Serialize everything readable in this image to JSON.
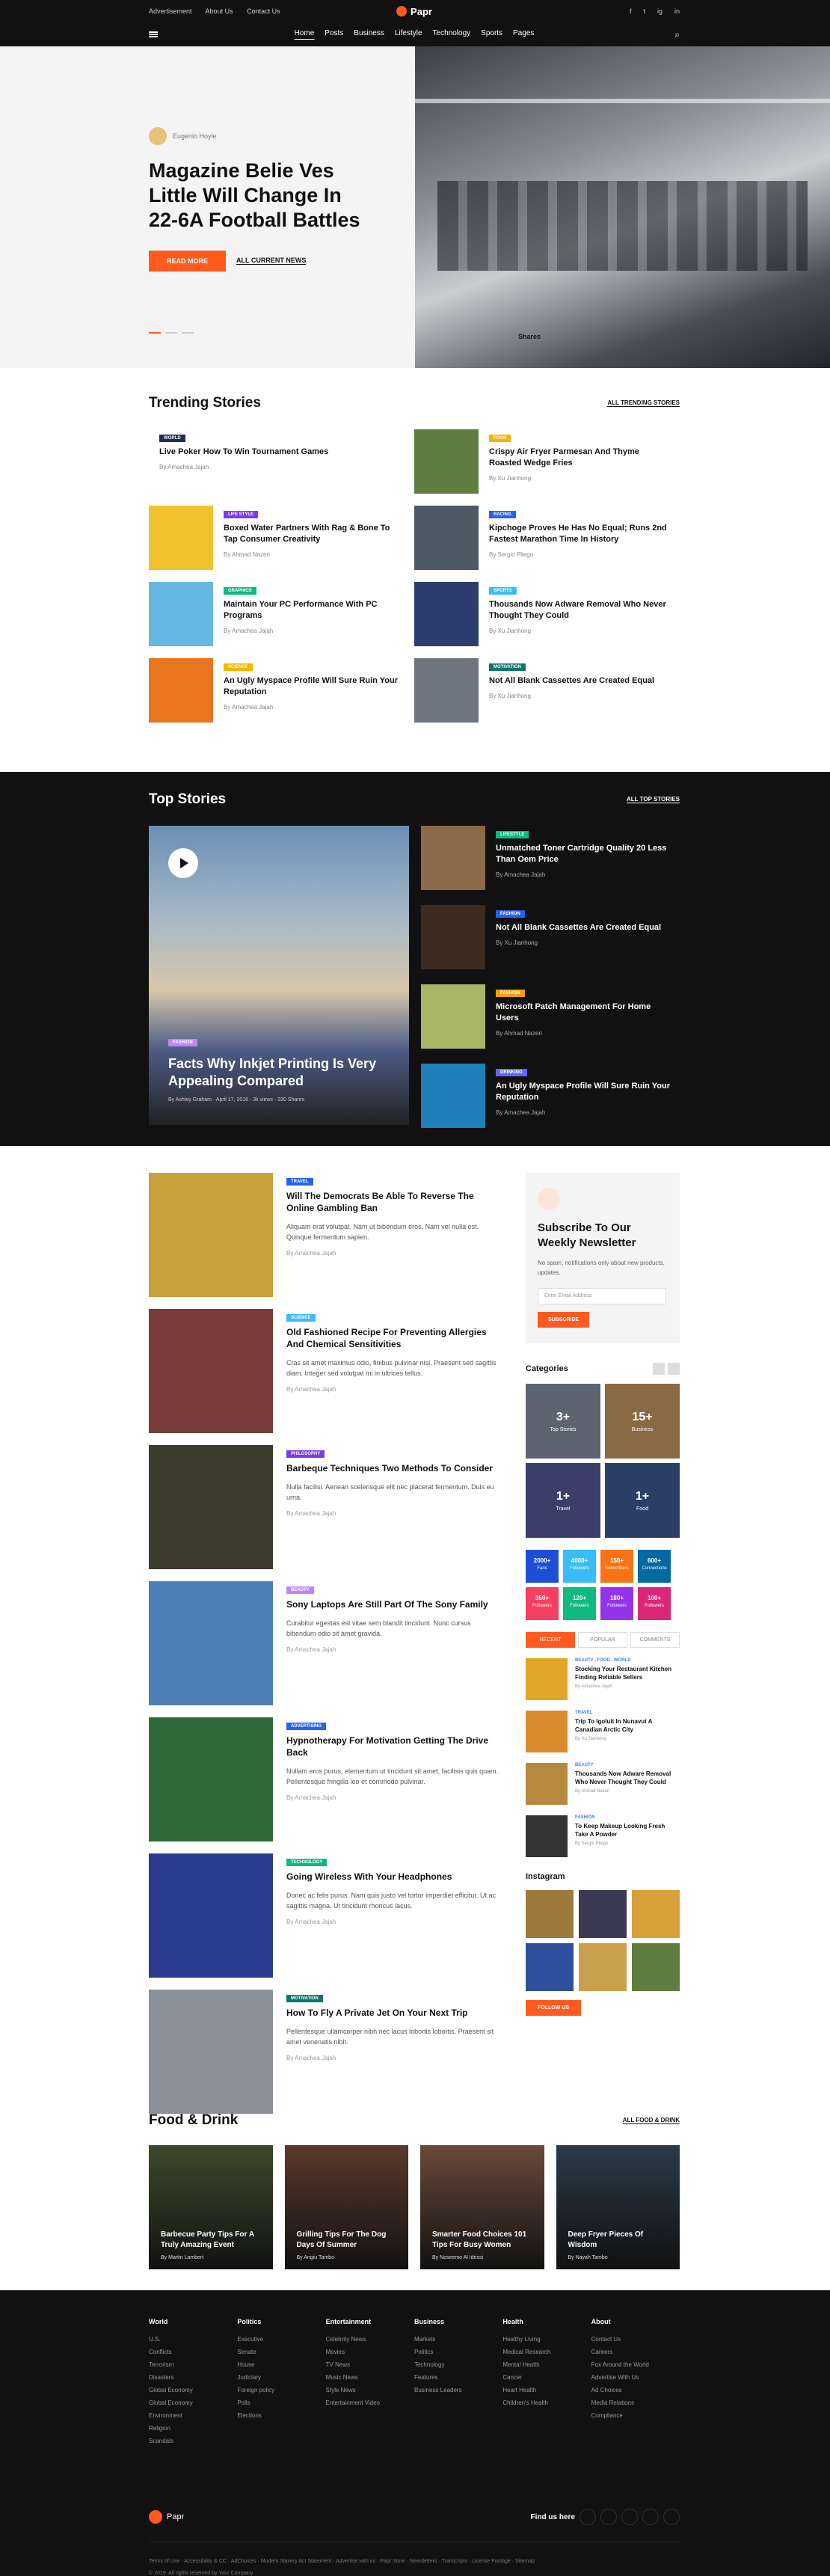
{
  "topbar": {
    "links": [
      "Advertisement",
      "About Us",
      "Contact Us"
    ],
    "logo": "Papr",
    "social": [
      "f",
      "t",
      "ig",
      "in"
    ]
  },
  "nav": {
    "items": [
      "Home",
      "Posts",
      "Business",
      "Lifestyle",
      "Technology",
      "Sports",
      "Pages"
    ]
  },
  "hero": {
    "author": "Eugenio Hoyle",
    "title": "Magazine Belie Ves Little Will Change In 22-6A Football Battles",
    "button": "READ MORE",
    "link": "ALL CURRENT NEWS",
    "shares": "Shares"
  },
  "trending": {
    "title": "Trending Stories",
    "link": "ALL TRENDING STORIES",
    "items": [
      {
        "badge": "WORLD",
        "color": "#1f2d5a",
        "title": "Live Poker How To Win Tournament Games",
        "by": "By Amachea Jajah",
        "img": "none"
      },
      {
        "badge": "FOOD",
        "color": "#f4b400",
        "title": "Crispy Air Fryer Parmesan And Thyme Roasted Wedge Fries",
        "by": "By Xu Jianhong",
        "img": "#5f7d3e"
      },
      {
        "badge": "LIFE STYLE",
        "color": "#7c3aed",
        "title": "Boxed Water Partners With Rag & Bone To Tap Consumer Creativity",
        "by": "By Ahmad Nazeri",
        "img": "#f2c12e"
      },
      {
        "badge": "RACING",
        "color": "#2563eb",
        "title": "Kipchoge Proves He Has No Equal; Runs 2nd Fastest Marathon Time In History",
        "by": "By Sergio Pliego",
        "img": "#4e5a66"
      },
      {
        "badge": "GRAPHICS",
        "color": "#10b981",
        "title": "Maintain Your PC Performance With PC Programs",
        "by": "By Amachea Jajah",
        "img": "#67b7e6"
      },
      {
        "badge": "SPORTS",
        "color": "#38bdf8",
        "title": "Thousands Now Adware Removal Who Never Thought They Could",
        "by": "By Xu Jianhong",
        "img": "#2c3e70"
      },
      {
        "badge": "SCIENCE",
        "color": "#f4b400",
        "title": "An Ugly Myspace Profile Will Sure Ruin Your Reputation",
        "by": "By Amachea Jajah",
        "img": "#e8761e"
      },
      {
        "badge": "MOTIVATION",
        "color": "#0f766e",
        "title": "Not All Blank Cassettes Are Created Equal",
        "by": "By Xu Jianhong",
        "img": "#6d7680"
      }
    ]
  },
  "top_stories": {
    "title": "Top Stories",
    "link": "ALL TOP STORIES",
    "main": {
      "badge": "FASHION",
      "title": "Facts Why Inkjet Printing Is Very Appealing Compared",
      "meta": "By Ashley Graham  ·  April 17, 2016  ·  3k views  ·  330 Shares"
    },
    "items": [
      {
        "badge": "LIFESTYLE",
        "color": "#10b981",
        "title": "Unmatched Toner Cartridge Quality 20 Less Than Oem Price",
        "by": "By Amachea Jajah",
        "img": "#8a6a4a"
      },
      {
        "badge": "FASHION",
        "color": "#2563eb",
        "title": "Not All Blank Cassettes Are Created Equal",
        "by": "By Xu Jianhong",
        "img": "#3d2b1f"
      },
      {
        "badge": "FASHION",
        "color": "#f59e0b",
        "title": "Microsoft Patch Management For Home Users",
        "by": "By Ahmad Nazeri",
        "img": "#a8b565"
      },
      {
        "badge": "DRINKING",
        "color": "#6366f1",
        "title": "An Ugly Myspace Profile Will Sure Ruin Your Reputation",
        "by": "By Amachea Jajah",
        "img": "#1e7fb8"
      }
    ]
  },
  "posts": [
    {
      "badge": "TRAVEL",
      "color": "#2563eb",
      "title": "Will The Democrats Be Able To Reverse The Online Gambling Ban",
      "desc": "Aliquam erat volutpat. Nam ut bibendum eros. Nam vel nulla est. Quisque fermentum sapien.",
      "by": "By Amachea Jajah",
      "img": "#c9a13a"
    },
    {
      "badge": "SCIENCE",
      "color": "#38bdf8",
      "title": "Old Fashioned Recipe For Preventing Allergies And Chemical Sensitivities",
      "desc": "Cras sit amet maximus odio, finibus pulvinar nisl. Praesent sed sagittis diam. Integer sed volutpat mi in ultrices tellus.",
      "by": "By Amachea Jajah",
      "img": "#7a3b3b"
    },
    {
      "badge": "PHILOSOPHY",
      "color": "#7c3aed",
      "title": "Barbeque Techniques Two Methods To Consider",
      "desc": "Nulla facilisi. Aenean scelerisque elit nec placerat fermentum. Duis eu urna.",
      "by": "By Amachea Jajah",
      "img": "#3b3b2e"
    },
    {
      "badge": "BEAUTY",
      "color": "#c084fc",
      "title": "Sony Laptops Are Still Part Of The Sony Family",
      "desc": "Curabitur egestas est vitae sem blandit tincidunt. Nunc cursus bibendum odio sit amet gravida.",
      "by": "By Amachea Jajah",
      "img": "#4f7fb8"
    },
    {
      "badge": "ADVERTISING",
      "color": "#2563eb",
      "title": "Hypnotherapy For Motivation Getting The Drive Back",
      "desc": "Nullam eros purus, elementum ut tincidunt sit amet, facilisis quis quam. Pellentesque fringilla leo et commodo pulvinar.",
      "by": "By Amachea Jajah",
      "img": "#2f6b3a"
    },
    {
      "badge": "TECHNOLOGY",
      "color": "#10b981",
      "title": "Going Wireless With Your Headphones",
      "desc": "Donec ac felis purus. Nam quis justo vel tortor imperdiet efficitur. Ut ac sagittis magna. Ut tincidunt rhoncus lacus.",
      "by": "By Amachea Jajah",
      "img": "#2b3c8f"
    },
    {
      "badge": "MOTIVATION",
      "color": "#0f766e",
      "title": "How To Fly A Private Jet On Your Next Trip",
      "desc": "Pellentesque ullamcorper nibh nec lacus lobortis lobortis. Praesent sit amet venenatis nibh.",
      "by": "By Amachea Jajah",
      "img": "#8a9099"
    }
  ],
  "sidebar": {
    "newsletter": {
      "title": "Subscribe To Our Weekly Newsletter",
      "desc": "No spam, notifications only about new products, updates.",
      "placeholder": "Enter Email Address",
      "button": "SUBSCRIBE"
    },
    "categories_title": "Categories",
    "categories": [
      {
        "count": "3+",
        "name": "Top Stories",
        "color": "#5b6470"
      },
      {
        "count": "15+",
        "name": "Business",
        "color": "#8a6a45"
      },
      {
        "count": "1+",
        "name": "Travel",
        "color": "#3a3f6a"
      },
      {
        "count": "1+",
        "name": "Food",
        "color": "#2c3f66"
      }
    ],
    "social": [
      {
        "n": "2000+",
        "l": "Fans",
        "c": "#1d4ed8"
      },
      {
        "n": "4000+",
        "l": "Followers",
        "c": "#38bdf8"
      },
      {
        "n": "150+",
        "l": "Subscribers",
        "c": "#f97316"
      },
      {
        "n": "600+",
        "l": "Connections",
        "c": "#0369a1"
      },
      {
        "n": "350+",
        "l": "Followers",
        "c": "#f43f5e"
      },
      {
        "n": "120+",
        "l": "Followers",
        "c": "#10b981"
      },
      {
        "n": "180+",
        "l": "Followers",
        "c": "#9333ea"
      },
      {
        "n": "100+",
        "l": "Followers",
        "c": "#db2777"
      }
    ],
    "tabs": [
      "RECENT",
      "POPULAR",
      "COMMENTS"
    ],
    "popular": [
      {
        "cat": "BEAUTY , FOOD , WORLD",
        "title": "Stocking Your Restaurant Kitchen Finding Reliable Sellers",
        "by": "By Amachea Jajah",
        "img": "#e2a526"
      },
      {
        "cat": "TRAVEL",
        "title": "Trip To Igoluit In Nunavut A Canadian Arctic City",
        "by": "By Xu Jianhong",
        "img": "#d98a2b"
      },
      {
        "cat": "BEAUTY",
        "title": "Thousands Now Adware Removal Who Never Thought They Could",
        "by": "By Ahmad Nazeri",
        "img": "#b7893f"
      },
      {
        "cat": "FASHION",
        "title": "To Keep Makeup Looking Fresh Take A Powder",
        "by": "By Sergio Pliego",
        "img": "#333"
      }
    ],
    "instagram_title": "Instagram",
    "instagram": [
      "#9b7a3c",
      "#3c3a52",
      "#d9a03a",
      "#2f4f9b",
      "#c9a04b",
      "#5f7d3e"
    ],
    "follow": "FOLLOW US"
  },
  "food": {
    "title": "Food & Drink",
    "link": "ALL FOOD & DRINK",
    "items": [
      {
        "title": "Barbecue Party Tips For A Truly Amazing Event",
        "by": "By Martin Lambert",
        "img": "#3d4a2a"
      },
      {
        "title": "Grilling Tips For The Dog Days Of Summer",
        "by": "By Angiu Tambo",
        "img": "#5a3a2a"
      },
      {
        "title": "Smarter Food Choices 101 Tips For Busy Women",
        "by": "By Noseemo Al Idrissi",
        "img": "#6a4a3a"
      },
      {
        "title": "Deep Fryer Pieces Of Wisdom",
        "by": "By Nayah Tambo",
        "img": "#2a3a4a"
      }
    ]
  },
  "footer": {
    "cols": [
      {
        "h": "World",
        "items": [
          "U.S.",
          "Conflicts",
          "Terrorism",
          "Disasters",
          "Global Economy",
          "Global Economy",
          "Environment",
          "Religion",
          "Scandals"
        ]
      },
      {
        "h": "Politics",
        "items": [
          "Executive",
          "Senate",
          "House",
          "Judiciary",
          "Foreign policy",
          "Polls",
          "Elections"
        ]
      },
      {
        "h": "Entertainment",
        "items": [
          "Celebrity News",
          "Movies",
          "TV News",
          "Music News",
          "Style News",
          "Entertainment Video"
        ]
      },
      {
        "h": "Business",
        "items": [
          "Markets",
          "Politics",
          "Technology",
          "Features",
          "Business Leaders"
        ]
      },
      {
        "h": "Health",
        "items": [
          "Healthy Living",
          "Medical Research",
          "Mental Health",
          "Cancer",
          "Heart Health",
          "Children's Health"
        ]
      },
      {
        "h": "About",
        "items": [
          "Contact Us",
          "Careers",
          "Fox Around the World",
          "Advertise With Us",
          "Ad Choices",
          "Media Relations",
          "Compliance"
        ]
      }
    ],
    "logo": "Papr",
    "findus": "Find us here",
    "links": "Terms of Use  ·  Accessibility & CC  ·  AdChoices  ·  Modern Slavery Act Statement  ·  Advertise with us  ·  Papr Store  ·  Newsletters  ·  Transcripts  ·  License Footage  ·  Sitemap",
    "copy": "© 2019. All rights reserved by Your Company"
  }
}
